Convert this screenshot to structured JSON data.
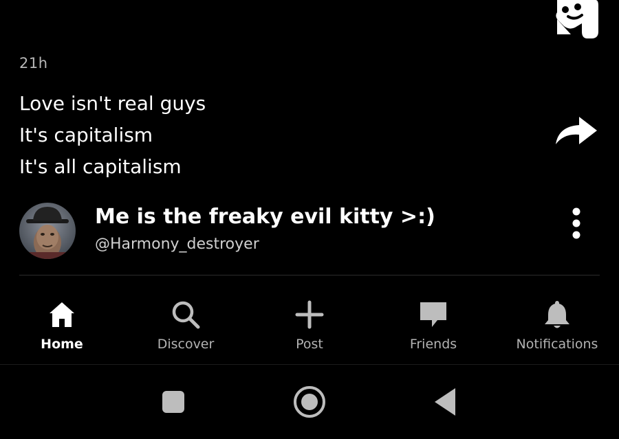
{
  "post": {
    "timestamp": "21h",
    "lines": [
      "Love isn't real guys",
      "It's capitalism",
      "It's all capitalism"
    ]
  },
  "author": {
    "display_name": "Me is the freaky evil kitty >:)",
    "handle": "@Harmony_destroyer"
  },
  "icons": {
    "app_logo": "app-logo-icon",
    "share": "share-arrow-icon",
    "more": "more-vertical-icon"
  },
  "tabs": [
    {
      "label": "Home",
      "icon": "home-icon",
      "active": true
    },
    {
      "label": "Discover",
      "icon": "search-icon",
      "active": false
    },
    {
      "label": "Post",
      "icon": "plus-icon",
      "active": false
    },
    {
      "label": "Friends",
      "icon": "chat-bubble-icon",
      "active": false
    },
    {
      "label": "Notifications",
      "icon": "bell-icon",
      "active": false
    }
  ],
  "system_nav": [
    "recents-square-icon",
    "home-circle-icon",
    "back-triangle-icon"
  ],
  "colors": {
    "background": "#000000",
    "text_primary": "#ffffff",
    "text_secondary": "#b8b8b8",
    "divider": "#2c2c2c",
    "system_icon": "#bdbdbd"
  }
}
